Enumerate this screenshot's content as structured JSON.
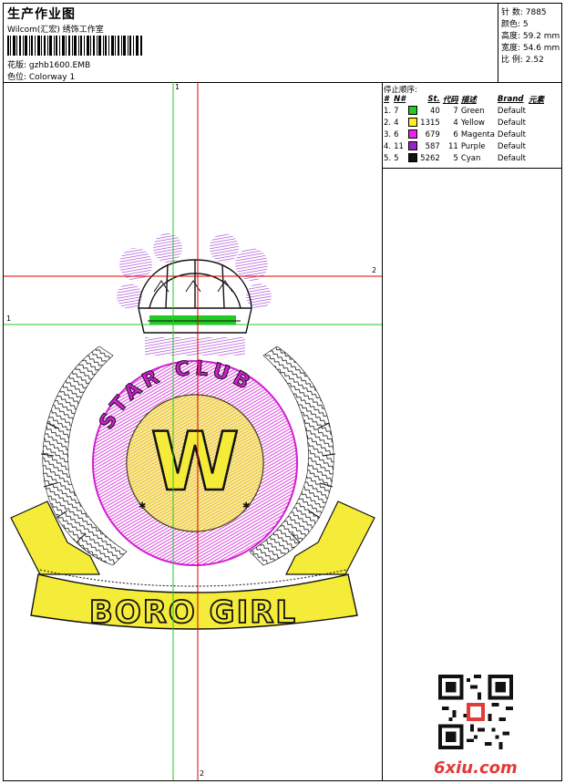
{
  "header": {
    "title": "生产作业图",
    "subtitle": "Wilcom(汇宏) 绣饰工作室",
    "filename": "花版:  gzhb1600.EMB",
    "colorway": "色位:  Colorway 1"
  },
  "specs": {
    "stitches": "针 数:  7885",
    "colors": "颜色:  5",
    "height": "高度:  59.2 mm",
    "width": "宽度:  54.6 mm",
    "ratio": "比 例:  2.52"
  },
  "stop_sequence": {
    "heading": "停止顺序:",
    "columns": [
      "#",
      "N#",
      "St.",
      "代码",
      "描述",
      "Brand",
      "元素"
    ],
    "rows": [
      {
        "idx": "1.",
        "n": "7",
        "color": "#22cc22",
        "st": "40",
        "code": "7",
        "desc": "Green",
        "brand": "Default"
      },
      {
        "idx": "2.",
        "n": "4",
        "color": "#ffee22",
        "st": "1315",
        "code": "4",
        "desc": "Yellow",
        "brand": "Default"
      },
      {
        "idx": "3.",
        "n": "6",
        "color": "#ee22ee",
        "st": "679",
        "code": "6",
        "desc": "Magenta",
        "brand": "Default"
      },
      {
        "idx": "4.",
        "n": "11",
        "color": "#9922cc",
        "st": "587",
        "code": "11",
        "desc": "Purple",
        "brand": "Default"
      },
      {
        "idx": "5.",
        "n": "5",
        "color": "#111111",
        "st": "5262",
        "code": "5",
        "desc": "Cyan",
        "brand": "Default"
      }
    ]
  },
  "design": {
    "center_letter": "W",
    "ring_text": "STAR CLUB",
    "banner_text": "BORO GIRL"
  },
  "guides": {
    "v1": "1",
    "v2": "2",
    "h1": "1",
    "h2": "2"
  },
  "watermark": "6xiu.com",
  "colors": {
    "guide_green": "#22cc22",
    "guide_red": "#dd0000"
  }
}
